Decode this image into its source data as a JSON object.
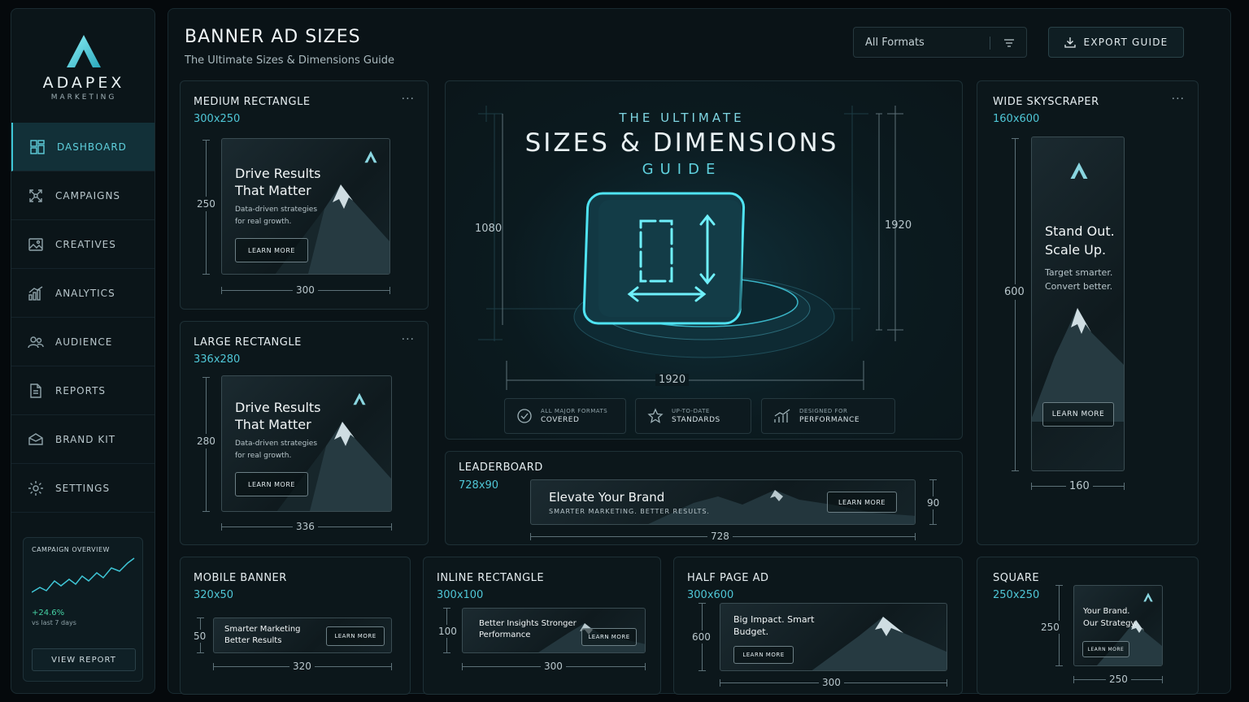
{
  "brand": {
    "name": "ADAPEX",
    "sub": "MARKETING"
  },
  "nav": [
    {
      "label": "DASHBOARD",
      "icon": "dashboard-icon",
      "active": true
    },
    {
      "label": "CAMPAIGNS",
      "icon": "campaigns-icon"
    },
    {
      "label": "CREATIVES",
      "icon": "creatives-icon"
    },
    {
      "label": "ANALYTICS",
      "icon": "analytics-icon"
    },
    {
      "label": "AUDIENCE",
      "icon": "audience-icon"
    },
    {
      "label": "REPORTS",
      "icon": "reports-icon"
    },
    {
      "label": "BRAND KIT",
      "icon": "brand-kit-icon"
    },
    {
      "label": "SETTINGS",
      "icon": "settings-icon"
    }
  ],
  "overview": {
    "title": "CAMPAIGN OVERVIEW",
    "change": "+24.6%",
    "period": "vs last 7 days",
    "button": "VIEW REPORT"
  },
  "header": {
    "title": "BANNER AD SIZES",
    "subtitle": "The Ultimate Sizes & Dimensions Guide",
    "filter": "All Formats",
    "export": "EXPORT GUIDE"
  },
  "colors": {
    "accent": "#4fc6d6",
    "positive": "#45d2a4",
    "bg": "#0a1317"
  },
  "hero": {
    "line1": "THE ULTIMATE",
    "line2": "SIZES & DIMENSIONS",
    "line3": "GUIDE",
    "dim_left": "1080",
    "dim_right": "1920",
    "dim_bottom": "1920",
    "badges": [
      {
        "l1": "ALL MAJOR FORMATS",
        "l2": "COVERED"
      },
      {
        "l1": "UP-TO-DATE",
        "l2": "STANDARDS"
      },
      {
        "l1": "DESIGNED FOR",
        "l2": "PERFORMANCE"
      }
    ]
  },
  "cards": {
    "medium": {
      "title": "MEDIUM RECTANGLE",
      "size": "300x250",
      "headline": "Drive Results That Matter",
      "text": "Data-driven strategies for real growth.",
      "cta": "LEARN MORE",
      "w": "300",
      "h": "250"
    },
    "large": {
      "title": "LARGE RECTANGLE",
      "size": "336x280",
      "headline": "Drive Results That Matter",
      "text": "Data-driven strategies for real growth.",
      "cta": "LEARN MORE",
      "w": "336",
      "h": "280"
    },
    "skyscraper": {
      "title": "WIDE SKYSCRAPER",
      "size": "160x600",
      "headline": "Stand Out. Scale Up.",
      "text": "Target smarter. Convert better.",
      "cta": "LEARN MORE",
      "w": "160",
      "h": "600"
    },
    "leaderboard": {
      "title": "LEADERBOARD",
      "size": "728x90",
      "headline": "Elevate Your Brand",
      "text": "SMARTER MARKETING. BETTER RESULTS.",
      "cta": "LEARN MORE",
      "w": "728",
      "h": "90"
    },
    "mobile": {
      "title": "MOBILE BANNER",
      "size": "320x50",
      "headline": "Smarter Marketing Better Results",
      "cta": "LEARN MORE",
      "w": "320",
      "h": "50"
    },
    "inline": {
      "title": "INLINE RECTANGLE",
      "size": "300x100",
      "headline": "Better Insights Stronger Performance",
      "cta": "LEARN MORE",
      "w": "300",
      "h": "100"
    },
    "halfpage": {
      "title": "HALF PAGE AD",
      "size": "300x600",
      "headline": "Big Impact. Smart Budget.",
      "cta": "LEARN MORE",
      "w": "300",
      "h": "600"
    },
    "square": {
      "title": "SQUARE",
      "size": "250x250",
      "headline": "Your Brand. Our Strategy.",
      "cta": "LEARN MORE",
      "w": "250",
      "h": "250"
    }
  },
  "card_menu": "···"
}
